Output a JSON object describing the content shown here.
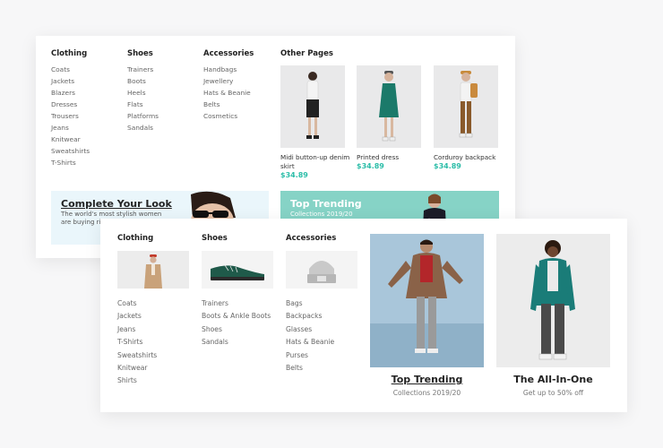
{
  "colors": {
    "accent": "#2bbda8",
    "banner_blue": "#eaf6fb",
    "banner_teal": "#86d3c6"
  },
  "back_menu": {
    "columns": [
      {
        "title": "Clothing",
        "items": [
          "Coats",
          "Jackets",
          "Blazers",
          "Dresses",
          "Trousers",
          "Jeans",
          "Knitwear",
          "Sweatshirts",
          "T-Shirts"
        ]
      },
      {
        "title": "Shoes",
        "items": [
          "Trainers",
          "Boots",
          "Heels",
          "Flats",
          "Platforms",
          "Sandals"
        ]
      },
      {
        "title": "Accessories",
        "items": [
          "Handbags",
          "Jewellery",
          "Hats & Beanie",
          "Belts",
          "Cosmetics"
        ]
      }
    ],
    "other_pages_title": "Other Pages",
    "products": [
      {
        "name": "Midi button-up denim skirt",
        "price": "$34.89"
      },
      {
        "name": "Printed dress",
        "price": "$34.89"
      },
      {
        "name": "Corduroy backpack",
        "price": "$34.89"
      }
    ],
    "banner_left": {
      "title": "Complete Your Look",
      "subtitle": "The world's most stylish women are buying right n"
    },
    "banner_right": {
      "title": "Top Trending",
      "subtitle": "Collections 2019/20"
    }
  },
  "front_menu": {
    "columns": [
      {
        "title": "Clothing",
        "image": "jacket-model-thumb",
        "items": [
          "Coats",
          "Jackets",
          "Jeans",
          "T-Shirts",
          "Sweatshirts",
          "Knitwear",
          "Shirts"
        ]
      },
      {
        "title": "Shoes",
        "image": "green-sneaker-thumb",
        "items": [
          "Trainers",
          "Boots & Ankle Boots",
          "Shoes",
          "Sandals"
        ]
      },
      {
        "title": "Accessories",
        "image": "beanie-thumb",
        "items": [
          "Bags",
          "Backpacks",
          "Glasses",
          "Hats & Beanie",
          "Purses",
          "Belts"
        ]
      }
    ],
    "promos": [
      {
        "title": "Top Trending",
        "subtitle": "Collections 2019/20"
      },
      {
        "title": "The All-In-One",
        "subtitle": "Get up to 50% off"
      }
    ]
  }
}
